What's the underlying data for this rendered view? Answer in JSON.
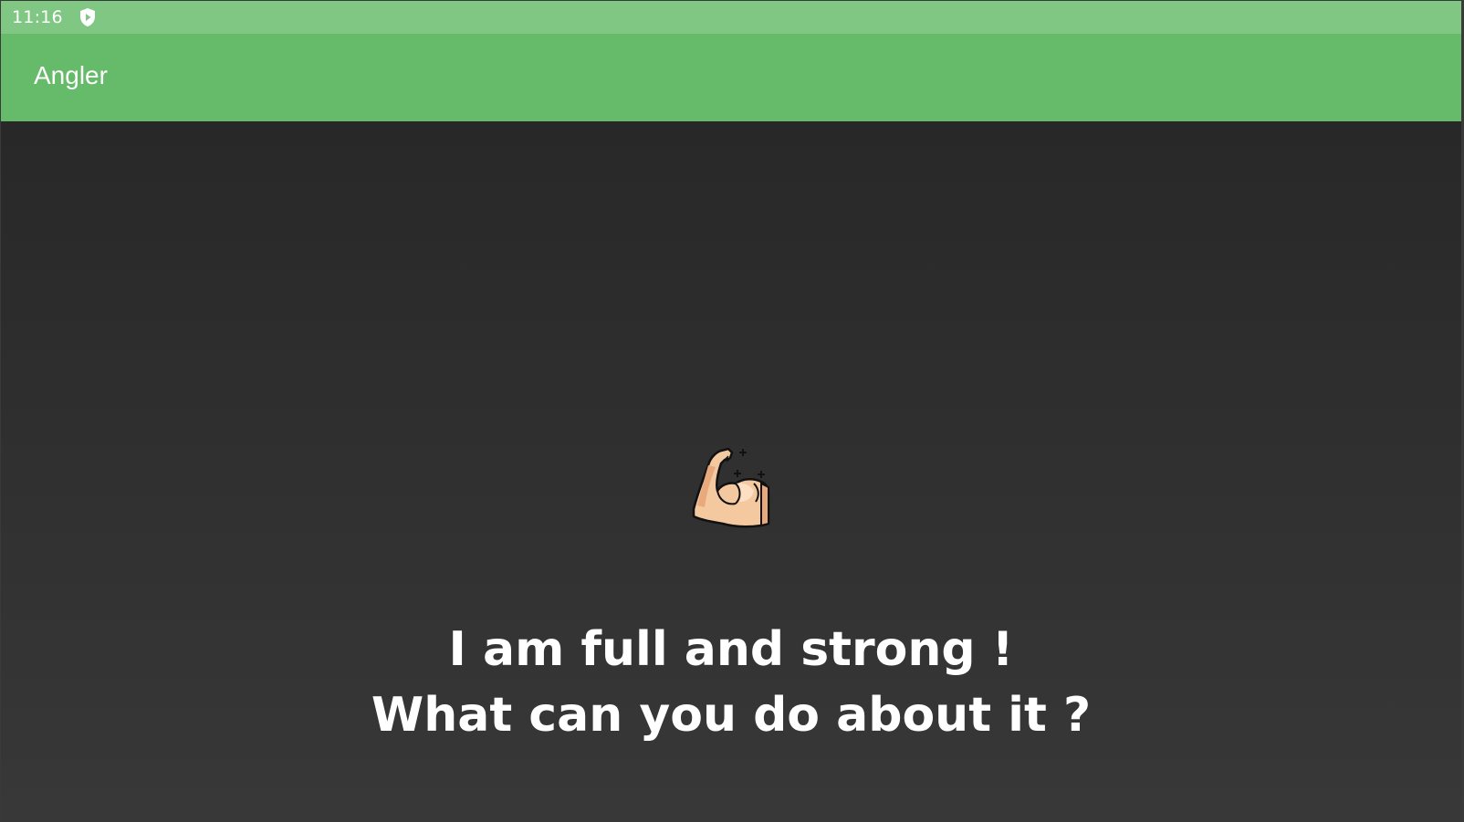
{
  "status_bar": {
    "time": "11:16",
    "icons": [
      "shield-play-icon"
    ]
  },
  "app_bar": {
    "title": "Angler"
  },
  "main": {
    "icon": "flexed-biceps-icon",
    "message_lines": [
      "I am full and strong !",
      "What can you do about it ?"
    ]
  },
  "colors": {
    "status_bar": "#81c784",
    "app_bar": "#66bb6a",
    "background_top": "#282828",
    "background_bottom": "#383838",
    "text": "#ffffff"
  }
}
